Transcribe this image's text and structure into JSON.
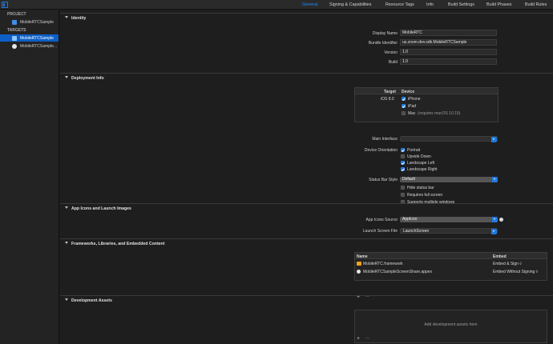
{
  "tabs": [
    {
      "label": "General",
      "active": true
    },
    {
      "label": "Signing & Capabilities"
    },
    {
      "label": "Resource Tags"
    },
    {
      "label": "Info"
    },
    {
      "label": "Build Settings"
    },
    {
      "label": "Build Phases"
    },
    {
      "label": "Build Rules"
    }
  ],
  "sidebar": {
    "project_header": "PROJECT",
    "project_item": "MobileRTCSample",
    "targets_header": "TARGETS",
    "targets": [
      {
        "label": "MobileRTCSample",
        "selected": true
      },
      {
        "label": "MobileRTCSample...",
        "selected": false
      }
    ]
  },
  "identity": {
    "title": "Identity",
    "display_name_label": "Display Name",
    "display_name": "MobileRTC",
    "bundle_id_label": "Bundle Identifier",
    "bundle_id": "us.zoom.dev.sdk.MobileRTCSample",
    "version_label": "Version",
    "version": "1.0",
    "build_label": "Build",
    "build": "1.0"
  },
  "deployment": {
    "title": "Deployment Info",
    "col_target": "Target",
    "col_device": "Device",
    "ios_version": "iOS 8.0",
    "devices": [
      {
        "label": "iPhone",
        "checked": true
      },
      {
        "label": "iPad",
        "checked": true
      },
      {
        "label": "Mac",
        "checked": false,
        "note": "(requires macOS 10.15)"
      }
    ],
    "main_interface_label": "Main Interface",
    "main_interface": "",
    "orientation_label": "Device Orientation",
    "orientations": [
      {
        "label": "Portrait",
        "checked": true
      },
      {
        "label": "Upside Down",
        "checked": false
      },
      {
        "label": "Landscape Left",
        "checked": true
      },
      {
        "label": "Landscape Right",
        "checked": true
      }
    ],
    "status_bar_label": "Status Bar Style",
    "status_bar": "Default",
    "status_options": [
      {
        "label": "Hide status bar",
        "checked": false
      },
      {
        "label": "Requires full screen",
        "checked": false
      },
      {
        "label": "Supports multiple windows",
        "checked": false
      }
    ]
  },
  "app_icons": {
    "title": "App Icons and Launch Images",
    "icons_source_label": "App Icons Source",
    "icons_source": "AppIcon",
    "launch_label": "Launch Screen File",
    "launch_file": "LaunchScreen"
  },
  "frameworks": {
    "title": "Frameworks, Libraries, and Embedded Content",
    "col_name": "Name",
    "col_embed": "Embed",
    "rows": [
      {
        "name": "MobileRTC.framework",
        "embed": "Embed & Sign ◊",
        "icon": "framework-icon"
      },
      {
        "name": "MobileRTCSampleScreenShare.appex",
        "embed": "Embed Without Signing ◊",
        "icon": "appex-icon"
      }
    ],
    "plus": "+",
    "minus": "—"
  },
  "dev_assets": {
    "title": "Development Assets",
    "placeholder": "Add development assets here",
    "plus": "+",
    "minus": "—"
  },
  "colors": {
    "accent": "#1f7ae0",
    "selection": "#0d5fc6"
  }
}
